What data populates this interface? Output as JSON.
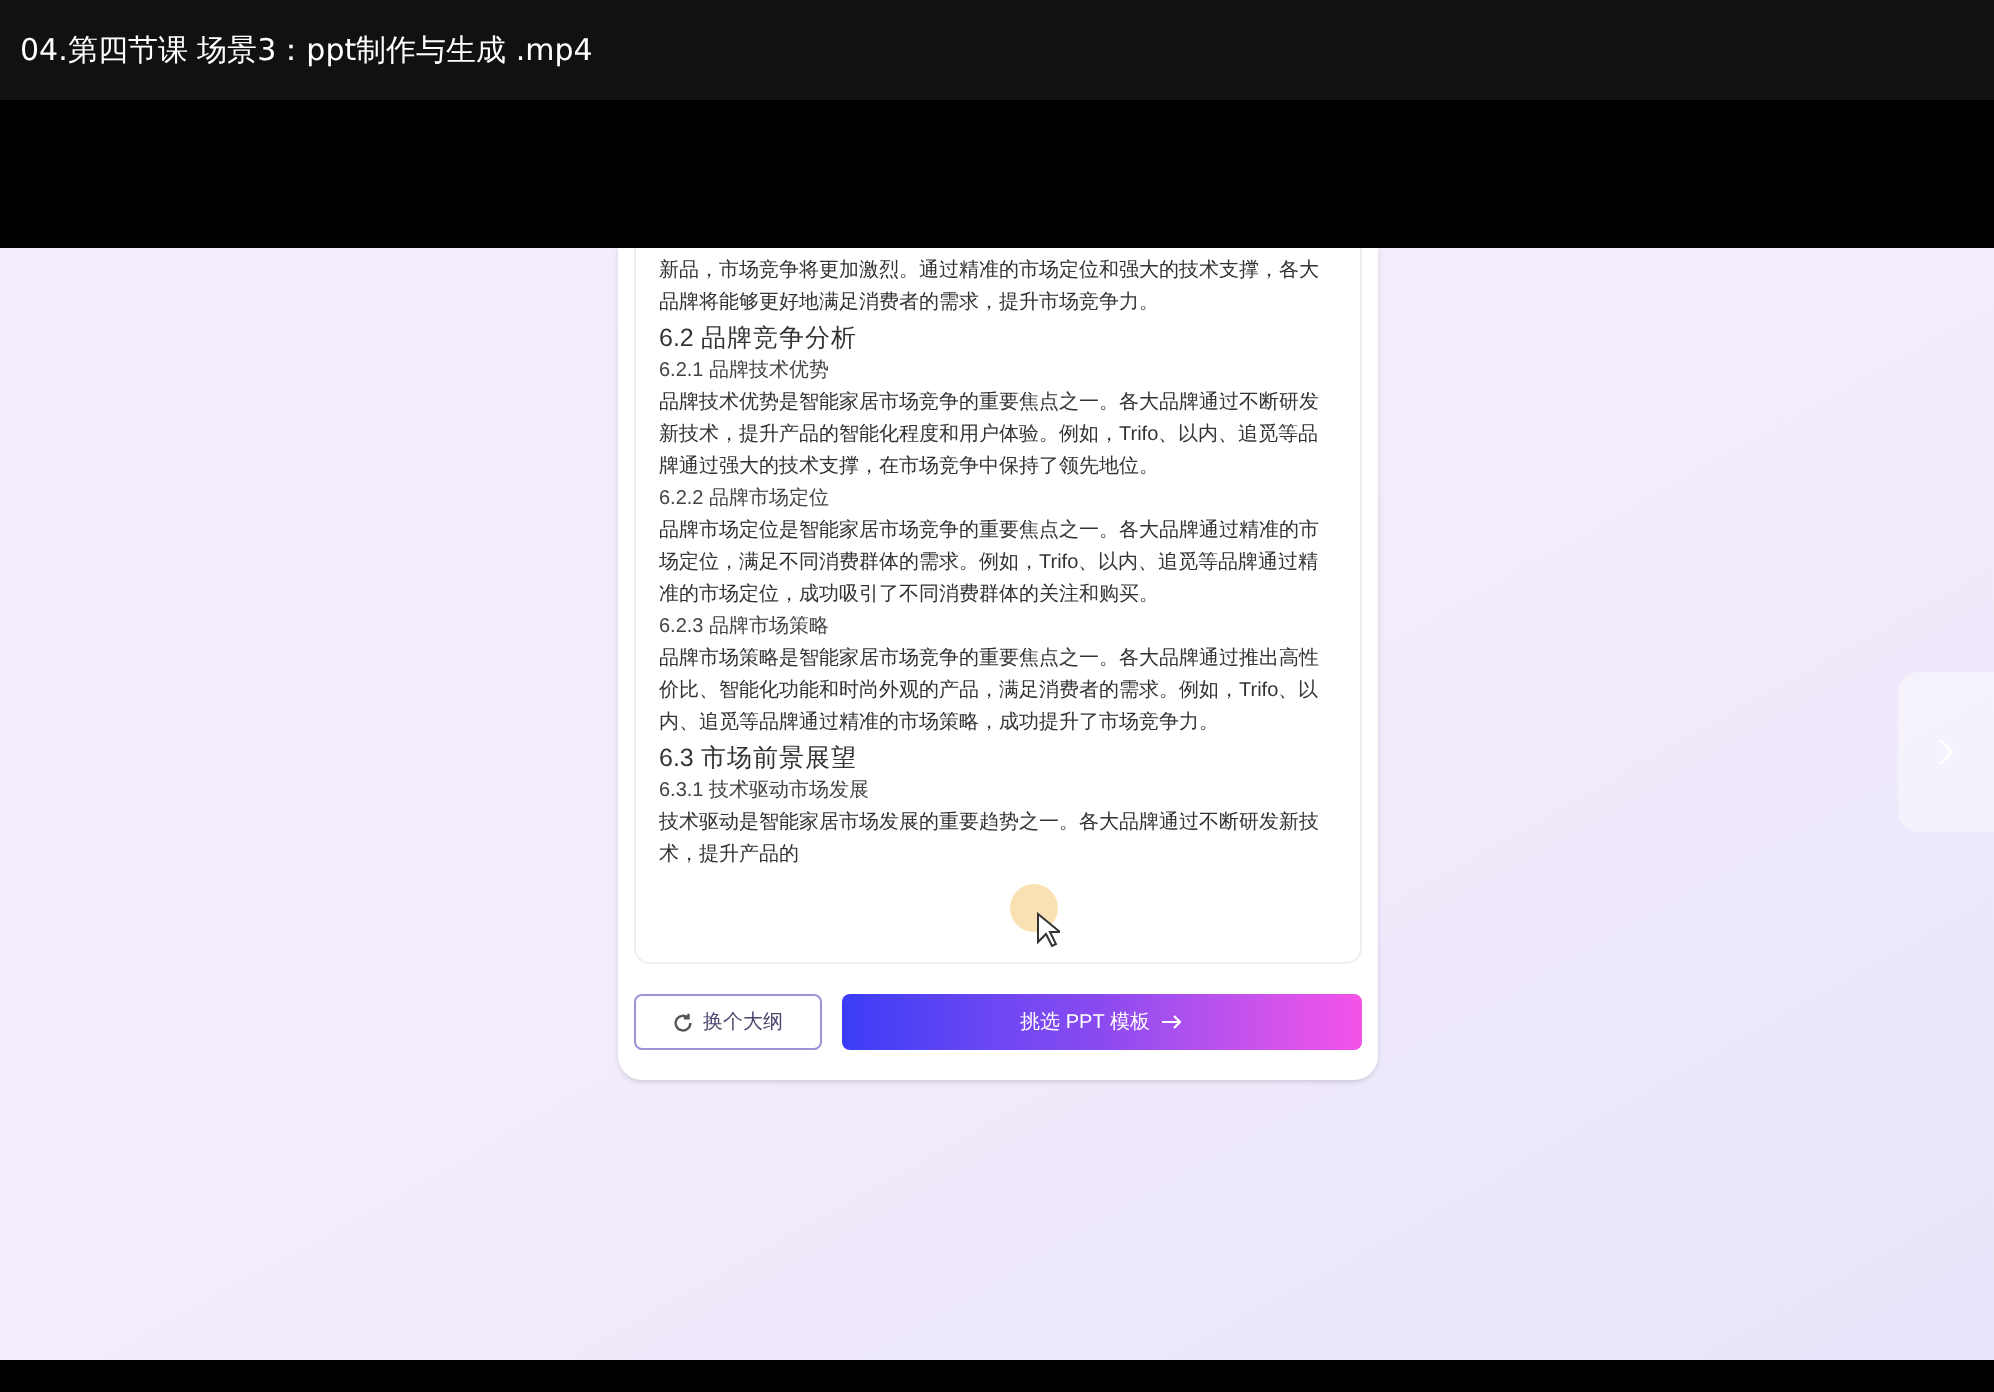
{
  "window": {
    "title": "04.第四节课 场景3：ppt制作与生成 .mp4"
  },
  "outline": {
    "blocks": [
      {
        "kind": "paragraph",
        "text": "新品，市场竞争将更加激烈。通过精准的市场定位和强大的技术支撑，各大品牌将能够更好地满足消费者的需求，提升市场竞争力。"
      },
      {
        "kind": "h2",
        "text": "6.2 品牌竞争分析"
      },
      {
        "kind": "h3",
        "text": "6.2.1 品牌技术优势"
      },
      {
        "kind": "paragraph",
        "text": "品牌技术优势是智能家居市场竞争的重要焦点之一。各大品牌通过不断研发新技术，提升产品的智能化程度和用户体验。例如，Trifo、以内、追觅等品牌通过强大的技术支撑，在市场竞争中保持了领先地位。"
      },
      {
        "kind": "h3",
        "text": "6.2.2 品牌市场定位"
      },
      {
        "kind": "paragraph",
        "text": "品牌市场定位是智能家居市场竞争的重要焦点之一。各大品牌通过精准的市场定位，满足不同消费群体的需求。例如，Trifo、以内、追觅等品牌通过精准的市场定位，成功吸引了不同消费群体的关注和购买。"
      },
      {
        "kind": "h3",
        "text": "6.2.3 品牌市场策略"
      },
      {
        "kind": "paragraph",
        "text": "品牌市场策略是智能家居市场竞争的重要焦点之一。各大品牌通过推出高性价比、智能化功能和时尚外观的产品，满足消费者的需求。例如，Trifo、以内、追觅等品牌通过精准的市场策略，成功提升了市场竞争力。"
      },
      {
        "kind": "h2",
        "text": "6.3 市场前景展望"
      },
      {
        "kind": "h3",
        "text": "6.3.1 技术驱动市场发展"
      },
      {
        "kind": "paragraph",
        "text": "技术驱动是智能家居市场发展的重要趋势之一。各大品牌通过不断研发新技术，提升产品的"
      }
    ]
  },
  "buttons": {
    "secondary": {
      "label": "换个大纲"
    },
    "primary": {
      "label": "挑选 PPT 模板"
    }
  }
}
